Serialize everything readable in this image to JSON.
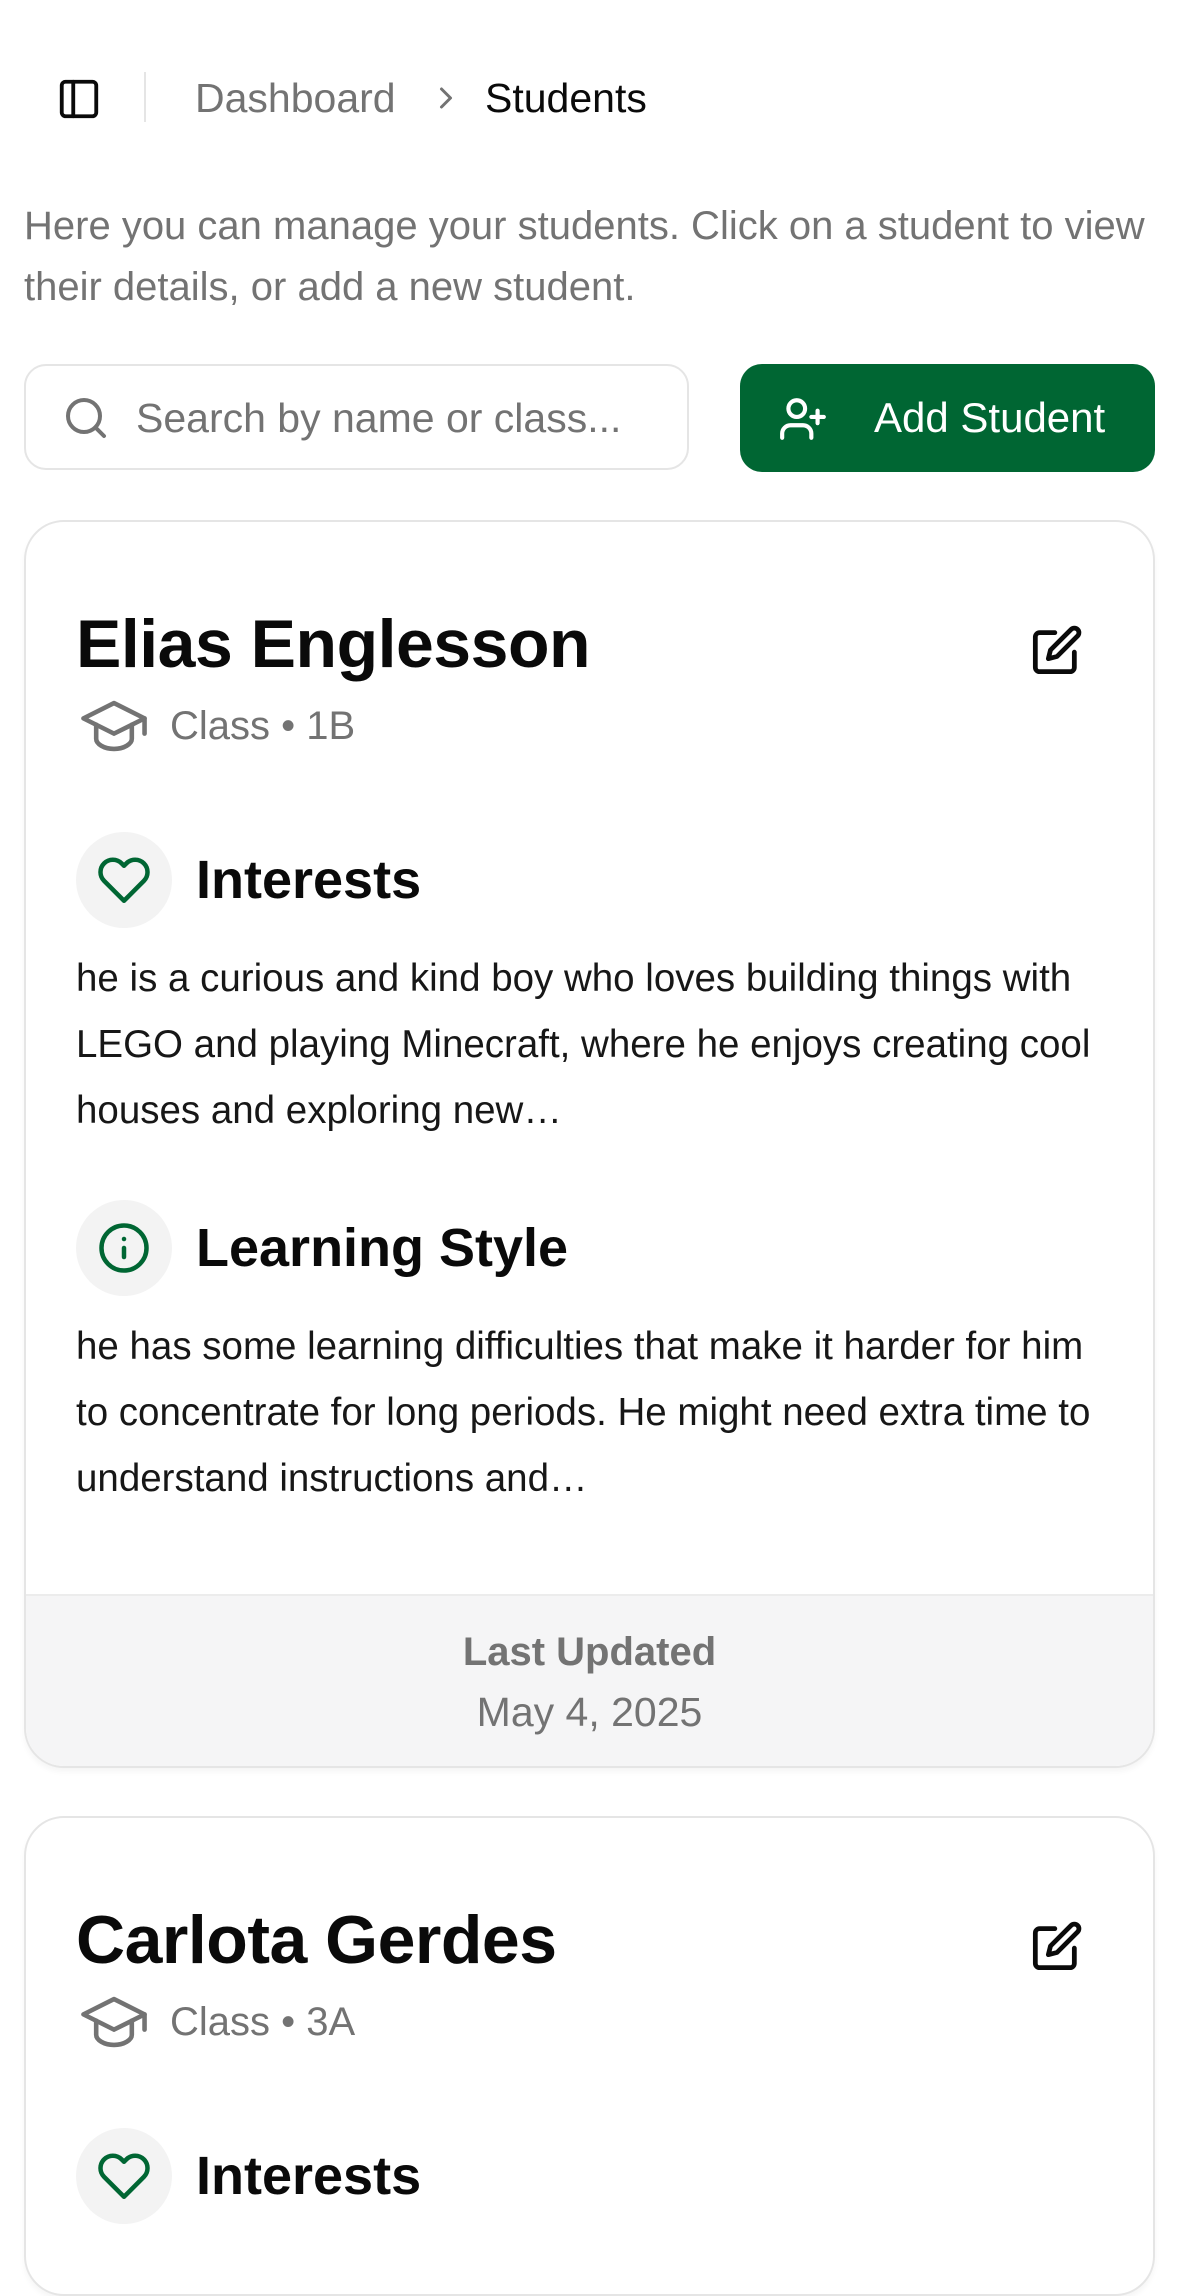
{
  "header": {
    "breadcrumb": [
      "Dashboard",
      "Students"
    ]
  },
  "intro": "Here you can manage your students. Click on a student to view their details, or add a new student.",
  "search": {
    "placeholder": "Search by name or class..."
  },
  "add_button_label": "Add Student",
  "students": [
    {
      "name": "Elias Englesson",
      "class_label": "Class",
      "class": "1B",
      "interests_title": "Interests",
      "interests": "he is a curious and kind boy who loves building things with LEGO and playing Minecraft, where he enjoys creating cool houses and exploring new…",
      "learning_title": "Learning Style",
      "learning": "he has some learning difficulties that make it harder for him to concentrate for long periods. He might need extra time to understand instructions and…",
      "updated_label": "Last Updated",
      "updated": "May 4, 2025"
    },
    {
      "name": "Carlota Gerdes",
      "class_label": "Class",
      "class": "3A",
      "interests_title": "Interests"
    }
  ],
  "colors": {
    "brand": "#006633",
    "muted_text": "#737373",
    "icon_circle": "#f3f3f3",
    "footer_bg": "#f5f5f6"
  }
}
